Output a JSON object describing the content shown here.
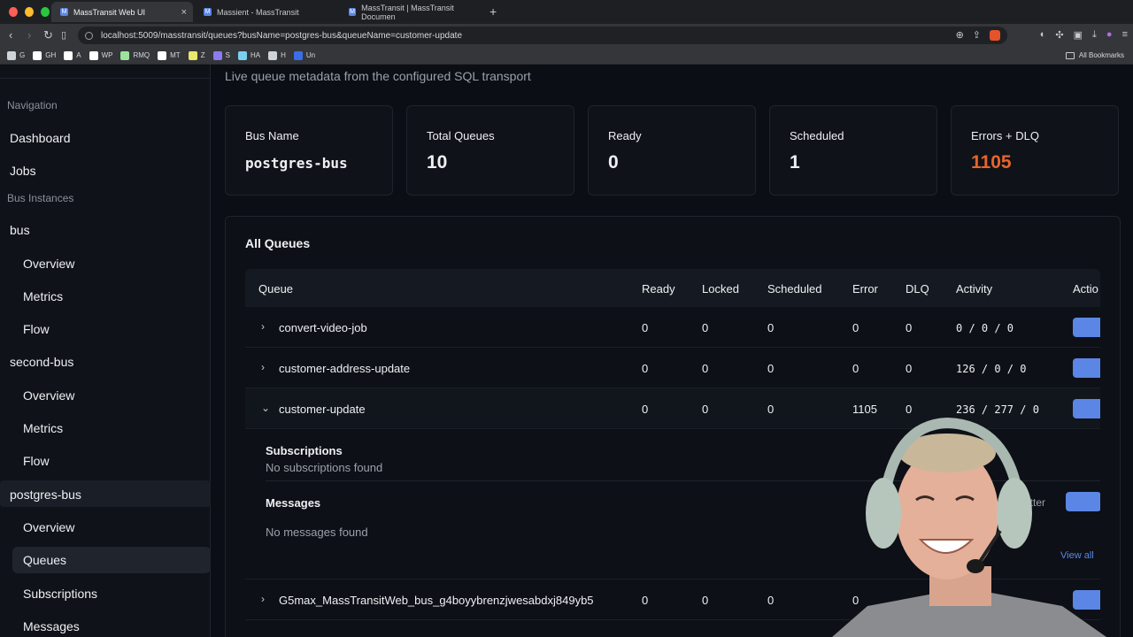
{
  "browser": {
    "tabs": [
      {
        "label": "MassTransit Web UI",
        "active": true
      },
      {
        "label": "Massient - MassTransit",
        "active": false
      },
      {
        "label": "MassTransit | MassTransit Documen",
        "active": false
      }
    ],
    "new_tab": "+",
    "close": "×",
    "url": "localhost:5009/masstransit/queues?busName=postgres-bus&queueName=customer-update",
    "bookmarks": [
      {
        "label": "G",
        "color": "#cfd3da"
      },
      {
        "label": "GH",
        "color": "#ffffff"
      },
      {
        "label": "A",
        "color": "#ffffff"
      },
      {
        "label": "WP",
        "color": "#ffffff"
      },
      {
        "label": "RMQ",
        "color": "#9be39b"
      },
      {
        "label": "MT",
        "color": "#ffffff"
      },
      {
        "label": "Z",
        "color": "#e8e86a"
      },
      {
        "label": "S",
        "color": "#8a7bf0"
      },
      {
        "label": "HA",
        "color": "#7ad0f0"
      },
      {
        "label": "H",
        "color": "#cfd3da"
      },
      {
        "label": "Un",
        "color": "#3a6ee8"
      }
    ],
    "all_bookmarks": "All Bookmarks"
  },
  "sidebar": {
    "section_navigation": "Navigation",
    "dashboard": "Dashboard",
    "jobs": "Jobs",
    "section_bus_instances": "Bus Instances",
    "buses": [
      {
        "name": "bus",
        "items": [
          "Overview",
          "Metrics",
          "Flow"
        ]
      },
      {
        "name": "second-bus",
        "items": [
          "Overview",
          "Metrics",
          "Flow"
        ]
      },
      {
        "name": "postgres-bus",
        "items": [
          "Overview",
          "Queues",
          "Subscriptions",
          "Messages"
        ]
      }
    ]
  },
  "main": {
    "subtitle": "Live queue metadata from the configured SQL transport",
    "cards": [
      {
        "label": "Bus Name",
        "value": "postgres-bus"
      },
      {
        "label": "Total Queues",
        "value": "10"
      },
      {
        "label": "Ready",
        "value": "0"
      },
      {
        "label": "Scheduled",
        "value": "1"
      },
      {
        "label": "Errors + DLQ",
        "value": "1105"
      }
    ],
    "panel_title": "All Queues",
    "columns": [
      "Queue",
      "Ready",
      "Locked",
      "Scheduled",
      "Error",
      "DLQ",
      "Activity",
      "Actio"
    ],
    "rows": [
      {
        "name": "convert-video-job",
        "ready": "0",
        "locked": "0",
        "scheduled": "0",
        "error": "0",
        "dlq": "0",
        "activity": "0 / 0 / 0",
        "chevron": "›"
      },
      {
        "name": "customer-address-update",
        "ready": "0",
        "locked": "0",
        "scheduled": "0",
        "error": "0",
        "dlq": "0",
        "activity": "126 / 0 / 0",
        "chevron": "›"
      },
      {
        "name": "customer-update",
        "ready": "0",
        "locked": "0",
        "scheduled": "0",
        "error": "1105",
        "dlq": "0",
        "activity": "236 / 277 / 0",
        "chevron": "⌄"
      },
      {
        "name": "G5max_MassTransitWeb_bus_g4boyybrenzjwesabdxj849yb5",
        "ready": "0",
        "locked": "0",
        "scheduled": "0",
        "error": "0",
        "dlq": "",
        "activity": "",
        "chevron": "›"
      }
    ],
    "detail": {
      "subscriptions_title": "Subscriptions",
      "subscriptions_empty": "No subscriptions found",
      "messages_title": "Messages",
      "messages_empty": "No messages found",
      "filter_text": "etter",
      "view_all": "View all"
    }
  },
  "colors": {
    "accent": "#5b86e5",
    "error": "#e8642a"
  }
}
